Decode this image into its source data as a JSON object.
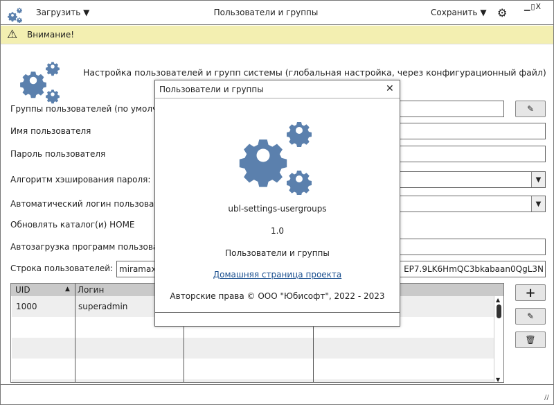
{
  "titlebar": {
    "load_label": "Загрузить",
    "title": "Пользователи и группы",
    "save_label": "Сохранить"
  },
  "warning": {
    "text": "Внимание!"
  },
  "header": {
    "text": "Настройка пользователей и групп системы (глобальная настройка, через конфигурационный файл)"
  },
  "form": {
    "groups_label": "Группы пользователей (по умолчани",
    "username_label": "Имя пользователя",
    "password_label": "Пароль пользователя",
    "hash_label": "Алгоритм хэширования пароля:",
    "autologin_label": "Автоматический логин пользовател",
    "home_label": "Обновлять каталог(и) HOME",
    "autostart_label": "Автозагрузка программ пользовате",
    "userstring_label": "Строка пользователей:",
    "userstring_value_start": "miramax",
    "userstring_value_end": "EP7.9LK6HmQC3bkabaan0QgL3N"
  },
  "table": {
    "columns": [
      "UID",
      "Логин",
      "",
      ""
    ],
    "rows": [
      [
        "1000",
        "superadmin",
        "",
        ""
      ]
    ]
  },
  "dialog": {
    "title": "Пользователи и группы",
    "app_name": "ubl-settings-usergroups",
    "version": "1.0",
    "description": "Пользователи и группы",
    "link": "Домашняя страница проекта",
    "copyright": "Авторские права © ООО \"Юбисофт\", 2022 - 2023"
  },
  "colors": {
    "accent": "#5b80ad",
    "warning_bg": "#f3efb1",
    "link": "#1a4f8f"
  }
}
